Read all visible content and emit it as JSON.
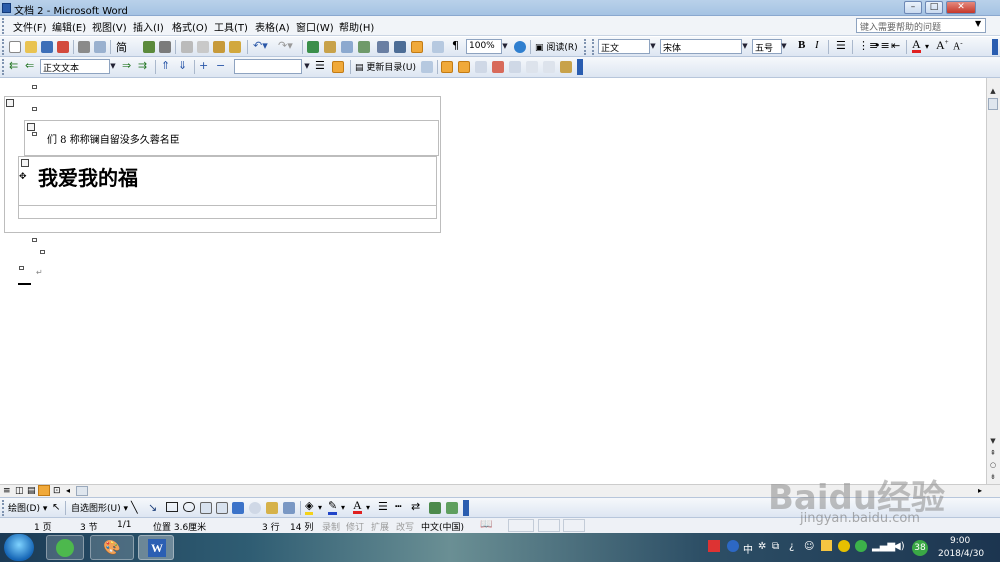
{
  "window": {
    "title": "文档 2 - Microsoft Word"
  },
  "menubar": {
    "items": [
      "文件(F)",
      "编辑(E)",
      "视图(V)",
      "插入(I)",
      "格式(O)",
      "工具(T)",
      "表格(A)",
      "窗口(W)",
      "帮助(H)"
    ],
    "help_placeholder": "键入需要帮助的问题"
  },
  "toolbar1": {
    "zoom": "100%",
    "read_label": "阅读(R)",
    "style_value": "正文",
    "font_value": "宋体",
    "size_value": "五号",
    "bold": "B",
    "italic": "I"
  },
  "toolbar2": {
    "style_value": "正文文本",
    "update_toc_label": "更新目录(U)"
  },
  "document": {
    "line1": "们 8 称称镧自留没多久蓉名臣",
    "heading": "我爱我的福"
  },
  "drawbar": {
    "draw_label": "绘图(D)",
    "autoshapes_label": "自选图形(U)"
  },
  "statusbar": {
    "page": "1 页",
    "section": "3 节",
    "page_of": "1/1",
    "position": "位置 3.6厘米",
    "line": "3 行",
    "column": "14 列",
    "rec": "录制",
    "trk": "修订",
    "ext": "扩展",
    "ovr": "改写",
    "language": "中文(中国)"
  },
  "taskbar": {
    "time": "9:00",
    "date": "2018/4/30",
    "badge": "38",
    "ime": "中"
  },
  "watermark": {
    "text": "Baidu经验",
    "url": "jingyan.baidu.com"
  }
}
